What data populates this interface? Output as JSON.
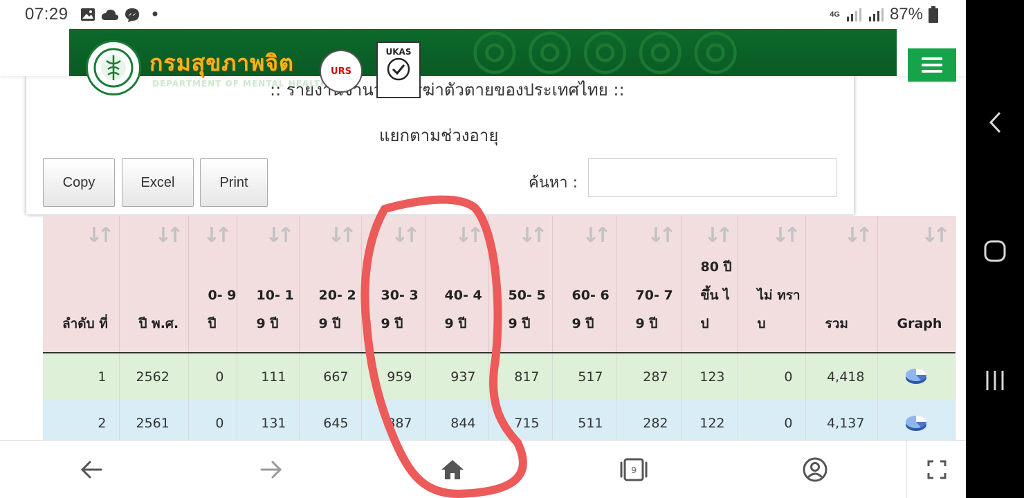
{
  "status_bar": {
    "time": "07:29",
    "network": "4G",
    "battery": "87%"
  },
  "header": {
    "org_name_th": "กรมสุขภาพจิต",
    "org_name_en": "DEPARTMENT OF MENTAL HEALTH",
    "cert_urs": "URS",
    "cert_ukas": "UKAS"
  },
  "report": {
    "title": ":: รายงานจำนวนการฆ่าตัวตายของประเทศไทย ::",
    "subtitle": "แยกตามช่วงอายุ"
  },
  "toolbar": {
    "copy_label": "Copy",
    "excel_label": "Excel",
    "print_label": "Print"
  },
  "search": {
    "label": "ค้นหา :",
    "value": ""
  },
  "table": {
    "columns": [
      "ลำดับ ที่",
      "ปี พ.ศ.",
      "0- 9 ปี",
      "10- 19 ปี",
      "20- 29 ปี",
      "30- 39 ปี",
      "40- 49 ปี",
      "50- 59 ปี",
      "60- 69 ปี",
      "70- 79 ปี",
      "80 ปี ขึ้น ไป",
      "ไม่ ทราบ",
      "รวม",
      "Graph"
    ],
    "rows": [
      [
        "1",
        "2562",
        "0",
        "111",
        "667",
        "959",
        "937",
        "817",
        "517",
        "287",
        "123",
        "0",
        "4,418"
      ],
      [
        "2",
        "2561",
        "0",
        "131",
        "645",
        "887",
        "844",
        "715",
        "511",
        "282",
        "122",
        "0",
        "4,137"
      ]
    ]
  },
  "browser_nav": {
    "tab_count": "9"
  },
  "colors": {
    "banner_green": "#0c6a2b",
    "menu_green": "#16a34a",
    "header_pink": "#f2dede",
    "row_green": "#dff0d8",
    "row_blue": "#d9edf7",
    "annotation_red": "#ec5a5a"
  }
}
